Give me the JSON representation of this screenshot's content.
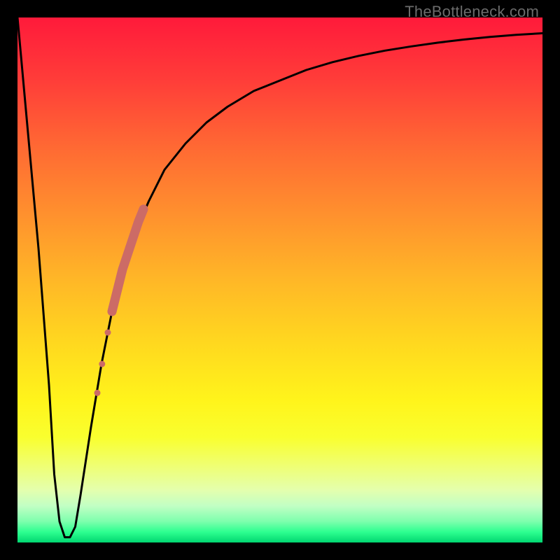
{
  "watermark": "TheBottleneck.com",
  "chart_data": {
    "type": "line",
    "title": "",
    "xlabel": "",
    "ylabel": "",
    "xlim": [
      0,
      100
    ],
    "ylim": [
      0,
      100
    ],
    "grid": false,
    "legend": false,
    "background_gradient_stops": [
      {
        "pos": 0,
        "color": "#ff1a3a"
      },
      {
        "pos": 50,
        "color": "#ffb727"
      },
      {
        "pos": 80,
        "color": "#f9ff2f"
      },
      {
        "pos": 100,
        "color": "#00d670"
      }
    ],
    "series": [
      {
        "name": "bottleneck-curve",
        "stroke": "#000000",
        "stroke_width": 3,
        "x": [
          0,
          2,
          4,
          6,
          7,
          8,
          9,
          10,
          11,
          12,
          14,
          16,
          18,
          20,
          22,
          25,
          28,
          32,
          36,
          40,
          45,
          50,
          55,
          60,
          65,
          70,
          75,
          80,
          85,
          90,
          95,
          100
        ],
        "y": [
          100,
          78,
          56,
          30,
          13,
          4,
          1,
          1,
          3,
          9,
          22,
          34,
          44,
          52,
          58,
          65,
          71,
          76,
          80,
          83,
          86,
          88,
          90,
          91.5,
          92.7,
          93.7,
          94.5,
          95.2,
          95.8,
          96.3,
          96.7,
          97
        ]
      }
    ],
    "markers": {
      "name": "highlight-segment",
      "color": "#cc6b66",
      "points": [
        {
          "x": 15.2,
          "y": 28.5,
          "r": 4.5
        },
        {
          "x": 16.1,
          "y": 34.0,
          "r": 4.5
        },
        {
          "x": 17.2,
          "y": 40.0,
          "r": 4.5
        }
      ],
      "thick_stroke_segment": {
        "x": [
          18.0,
          19.0,
          20.0,
          21.0,
          22.0,
          23.0,
          24.0
        ],
        "y": [
          44.0,
          48.0,
          52.0,
          55.0,
          58.0,
          61.0,
          63.5
        ],
        "stroke_width": 13
      }
    }
  }
}
